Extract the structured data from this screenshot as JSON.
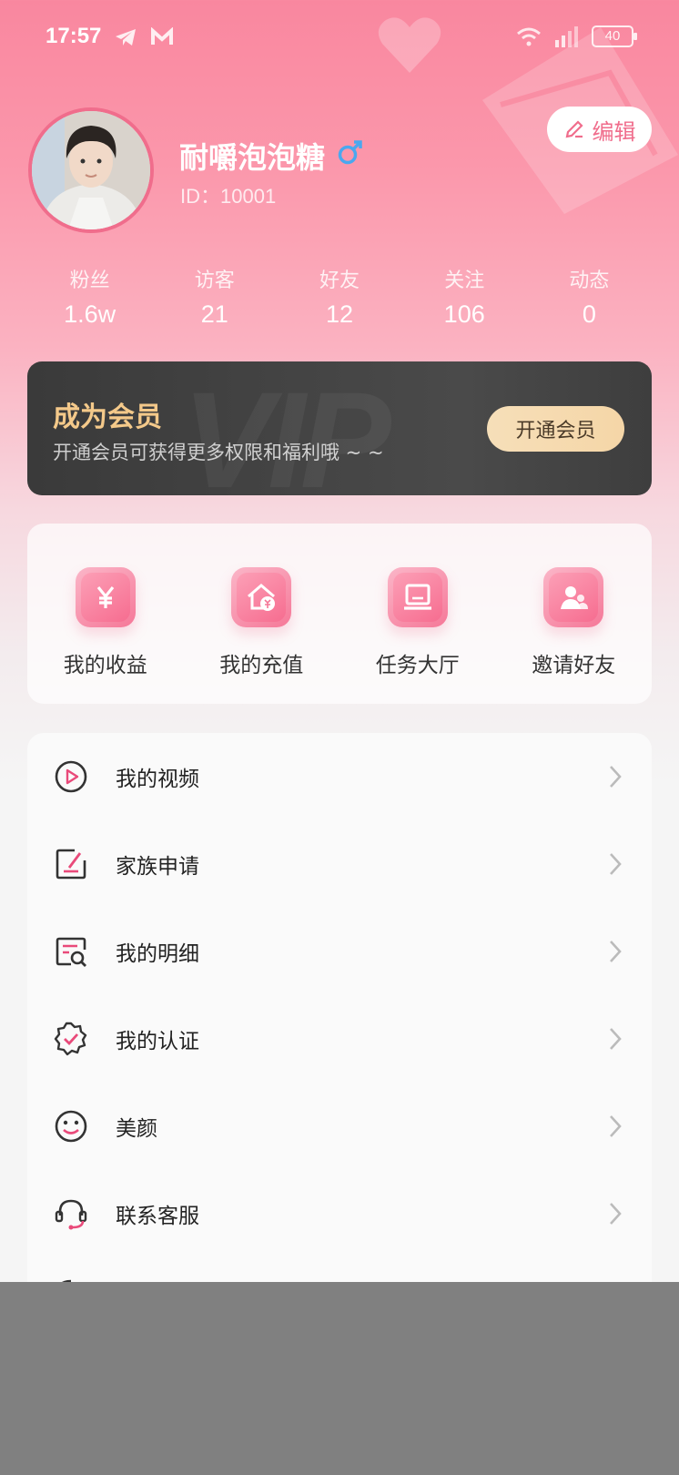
{
  "status_bar": {
    "time": "17:57",
    "battery": "40"
  },
  "profile": {
    "name": "耐嚼泡泡糖",
    "id_text": "ID：10001",
    "edit_label": "编辑"
  },
  "stats": [
    {
      "label": "粉丝",
      "value": "1.6w"
    },
    {
      "label": "访客",
      "value": "21"
    },
    {
      "label": "好友",
      "value": "12"
    },
    {
      "label": "关注",
      "value": "106"
    },
    {
      "label": "动态",
      "value": "0"
    }
  ],
  "vip": {
    "watermark": "VIP",
    "title": "成为会员",
    "subtitle": "开通会员可获得更多权限和福利哦 ~ ~",
    "button": "开通会员"
  },
  "quick_actions": [
    {
      "label": "我的收益",
      "icon": "yen-icon"
    },
    {
      "label": "我的充值",
      "icon": "recharge-icon"
    },
    {
      "label": "任务大厅",
      "icon": "task-hall-icon"
    },
    {
      "label": "邀请好友",
      "icon": "invite-friends-icon"
    }
  ],
  "menu": [
    {
      "label": "我的视频",
      "icon": "video-play-icon"
    },
    {
      "label": "家族申请",
      "icon": "edit-form-icon"
    },
    {
      "label": "我的明细",
      "icon": "details-search-icon"
    },
    {
      "label": "我的认证",
      "icon": "verified-badge-icon"
    },
    {
      "label": "美颜",
      "icon": "smile-face-icon"
    },
    {
      "label": "联系客服",
      "icon": "headset-icon"
    }
  ],
  "colors": {
    "accent": "#f06d8c",
    "vip_gold": "#f4c98a",
    "vip_bg": "#3a3a3a"
  }
}
